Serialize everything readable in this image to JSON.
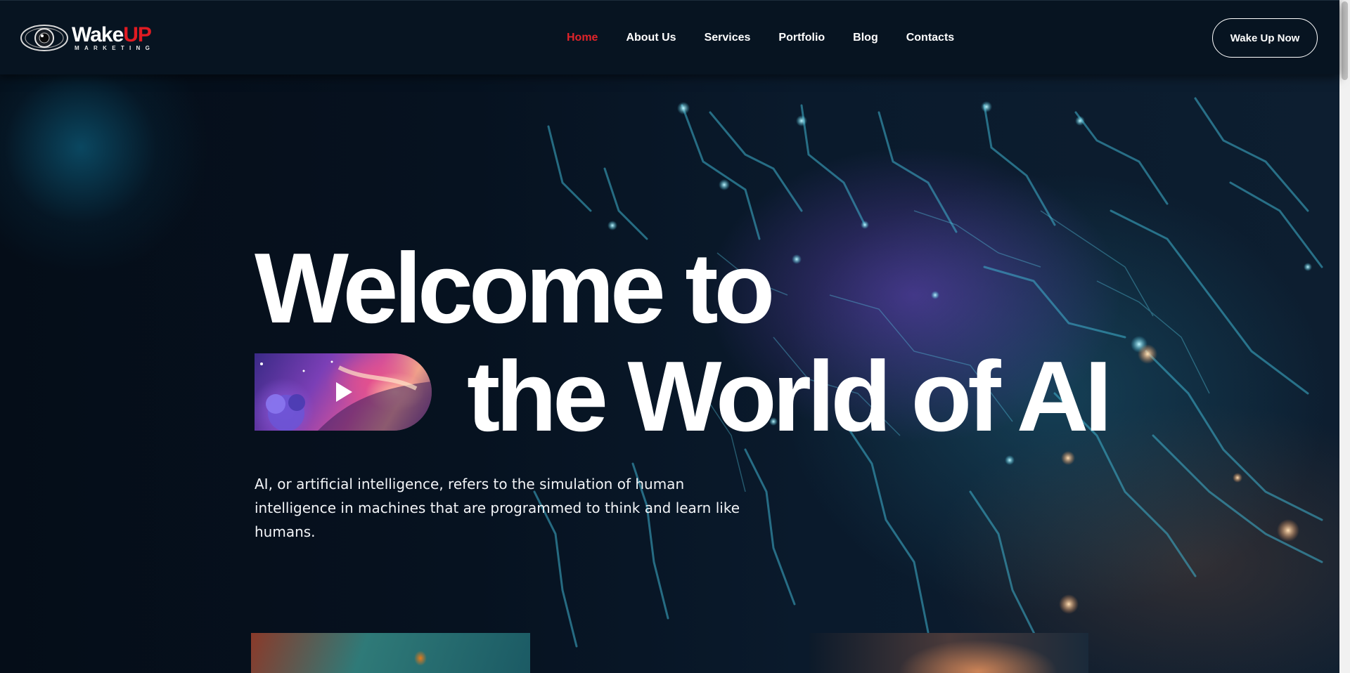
{
  "logo": {
    "word_primary": "Wake",
    "word_accent": "UP",
    "tagline": "MARKETING"
  },
  "nav": {
    "items": [
      {
        "label": "Home",
        "active": true
      },
      {
        "label": "About Us",
        "active": false
      },
      {
        "label": "Services",
        "active": false
      },
      {
        "label": "Portfolio",
        "active": false
      },
      {
        "label": "Blog",
        "active": false
      },
      {
        "label": "Contacts",
        "active": false
      }
    ]
  },
  "cta": {
    "label": "Wake Up Now"
  },
  "hero": {
    "title_line_1": "Welcome to",
    "title_line_2": "the World of AI",
    "description": "AI, or artificial intelligence, refers to the simulation of human intelligence in machines that are programmed to think and learn like humans.",
    "video_icon": "play-icon"
  },
  "colors": {
    "accent": "#e01b22",
    "background": "#040c17",
    "header": "#071421",
    "text": "#ffffff"
  }
}
